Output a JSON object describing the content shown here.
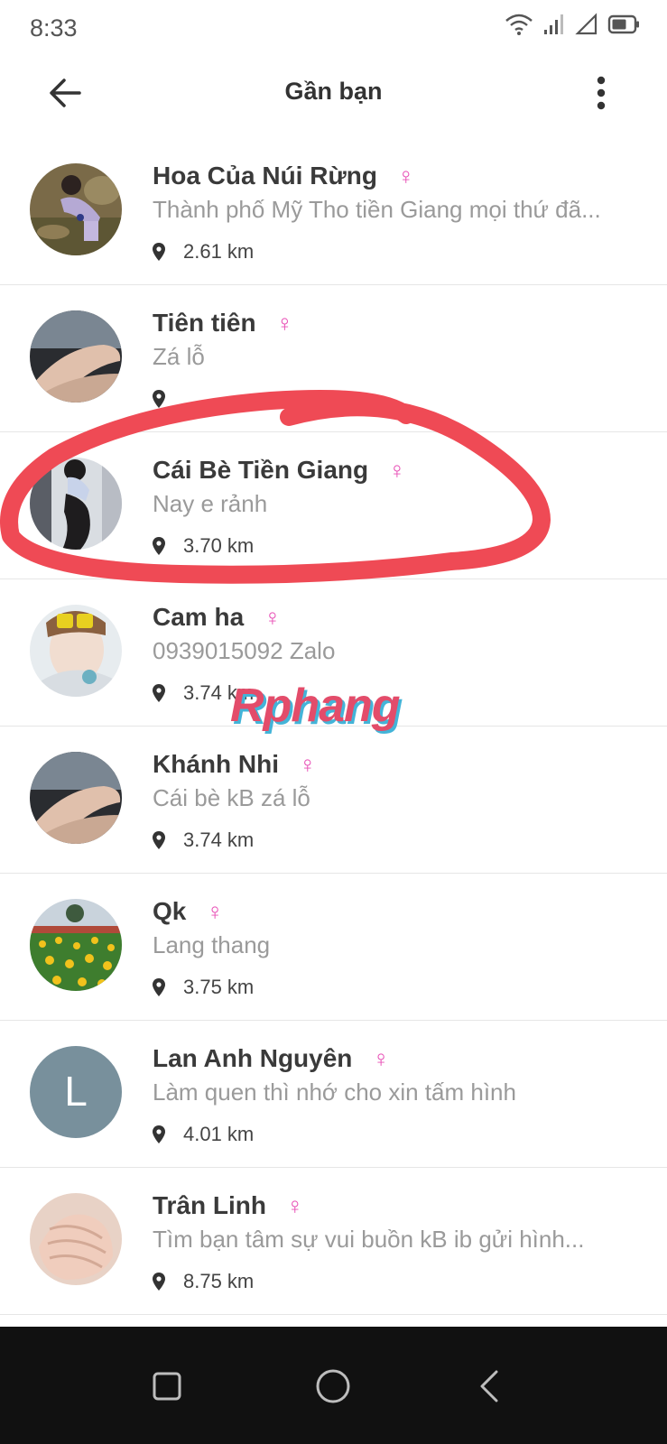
{
  "status_bar": {
    "time": "8:33",
    "icons": [
      "wifi-icon",
      "signal-icon",
      "no-sim-icon",
      "battery-icon"
    ]
  },
  "header": {
    "title": "Gần bạn",
    "back_icon": "arrow-left-icon",
    "menu_icon": "more-vertical-icon"
  },
  "colors": {
    "gender_female": "#e84fb6",
    "annotation": "#ef4a55",
    "watermark_primary": "#e34c6a",
    "watermark_shadow": "#43b4d8"
  },
  "users": [
    {
      "name": "Hoa Của Núi Rừng",
      "status": "Thành phố Mỹ Tho tiền Giang mọi thứ đã...",
      "distance": "2.61 km",
      "gender": "♀",
      "avatar": "photo-woman-crouching"
    },
    {
      "name": "Tiên tiên",
      "status": "Zá lỗ",
      "distance": "",
      "gender": "♀",
      "avatar": "photo-legs"
    },
    {
      "name": "Cái Bè Tiền Giang",
      "status": "Nay e rảnh",
      "distance": "3.70 km",
      "gender": "♀",
      "avatar": "photo-woman-standing"
    },
    {
      "name": "Cam ha",
      "status": "0939015092 Zalo",
      "distance": "3.74 km",
      "gender": "♀",
      "avatar": "photo-selfie-sticker"
    },
    {
      "name": "Khánh Nhi",
      "status": "Cái bè kB zá lỗ",
      "distance": "3.74 km",
      "gender": "♀",
      "avatar": "photo-legs"
    },
    {
      "name": "Qk",
      "status": "Lang thang",
      "distance": "3.75 km",
      "gender": "♀",
      "avatar": "photo-flower-field"
    },
    {
      "name": "Lan Anh Nguyên",
      "status": "Làm quen thì nhớ cho xin tấm hình",
      "distance": "4.01 km",
      "gender": "♀",
      "avatar": "letter-avatar",
      "avatar_letter": "L"
    },
    {
      "name": "Trân Linh",
      "status": "Tìm bạn tâm sự vui buồn  kB ib gửi hình...",
      "distance": "8.75 km",
      "gender": "♀",
      "avatar": "photo-hand"
    }
  ],
  "watermark": "Rphang",
  "nav_bar": {
    "icons": [
      "recent-apps-icon",
      "home-icon",
      "back-icon"
    ]
  }
}
